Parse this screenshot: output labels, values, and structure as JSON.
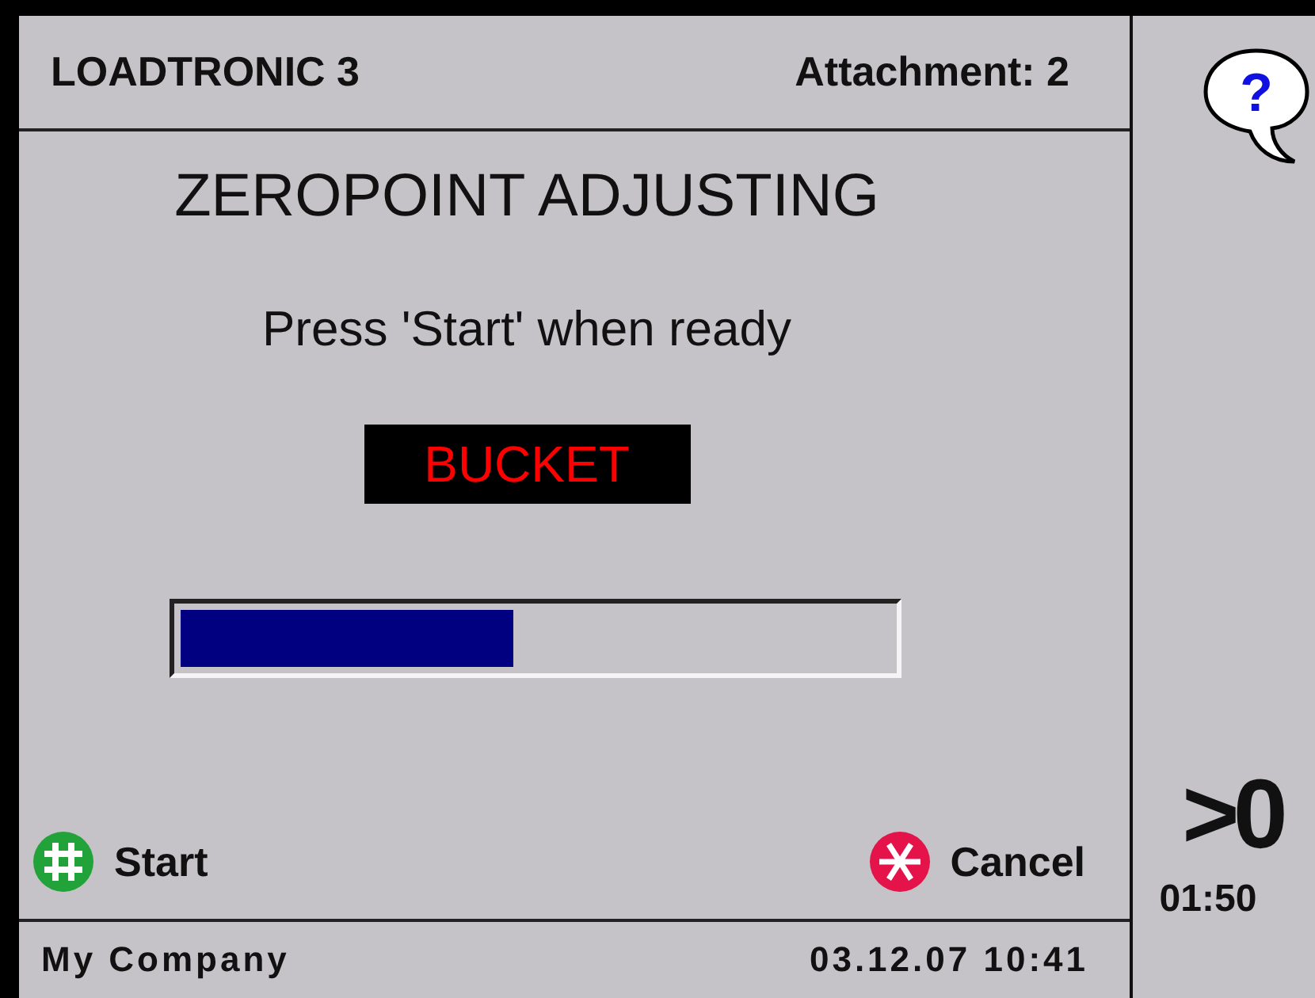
{
  "header": {
    "title": "LOADTRONIC 3",
    "attachment": "Attachment: 2"
  },
  "main": {
    "heading": "ZEROPOINT ADJUSTING",
    "instruction": "Press 'Start' when ready",
    "tool": "BUCKET",
    "progress": {
      "level": 0.47
    }
  },
  "actions": [
    {
      "kind": "start",
      "label": "Start"
    },
    {
      "kind": "cancel",
      "label": "Cancel"
    }
  ],
  "footer": {
    "company": "My Company",
    "datetime": "03.12.07 10:41"
  },
  "side": {
    "help": "?",
    "zero_indicator": ">0",
    "time": "01:50"
  }
}
